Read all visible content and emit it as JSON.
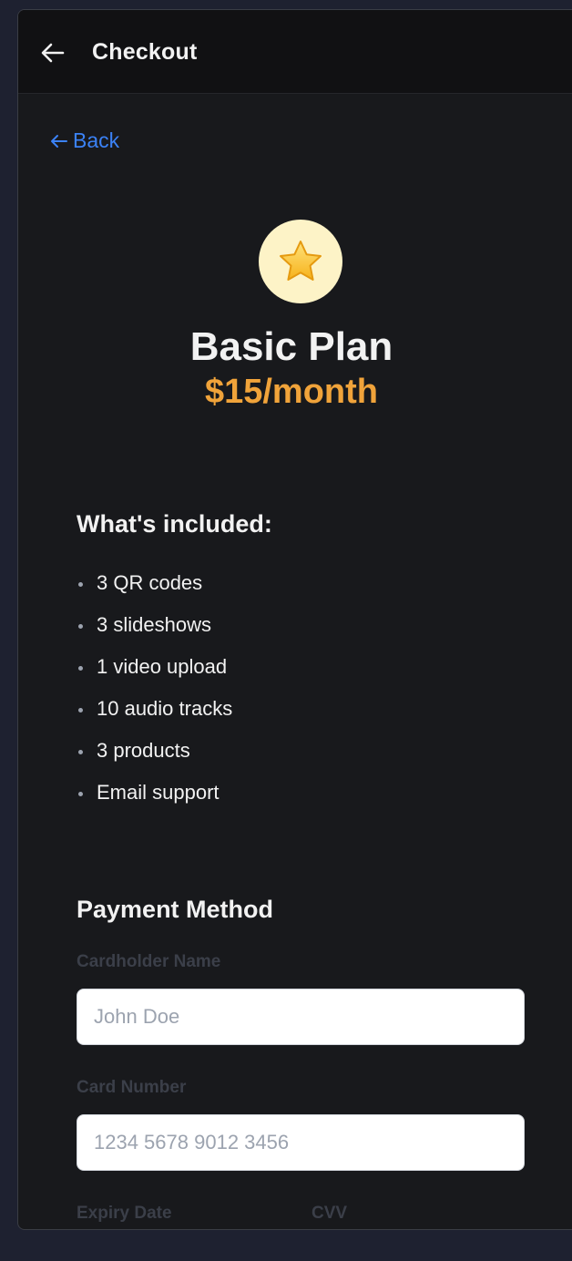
{
  "header": {
    "title": "Checkout"
  },
  "back_link": {
    "label": "Back"
  },
  "plan": {
    "icon": "star-icon",
    "name": "Basic Plan",
    "price": "$15/month",
    "accent_color": "#f0a33a"
  },
  "included": {
    "title": "What's included:",
    "items": [
      "3 QR codes",
      "3 slideshows",
      "1 video upload",
      "10 audio tracks",
      "3 products",
      "Email support"
    ]
  },
  "payment": {
    "title": "Payment Method",
    "cardholder_label": "Cardholder Name",
    "cardholder_placeholder": "John Doe",
    "card_number_label": "Card Number",
    "card_number_placeholder": "1234 5678 9012 3456",
    "expiry_label": "Expiry Date",
    "cvv_label": "CVV"
  },
  "colors": {
    "link": "#3b82f6",
    "background": "#18191c"
  }
}
